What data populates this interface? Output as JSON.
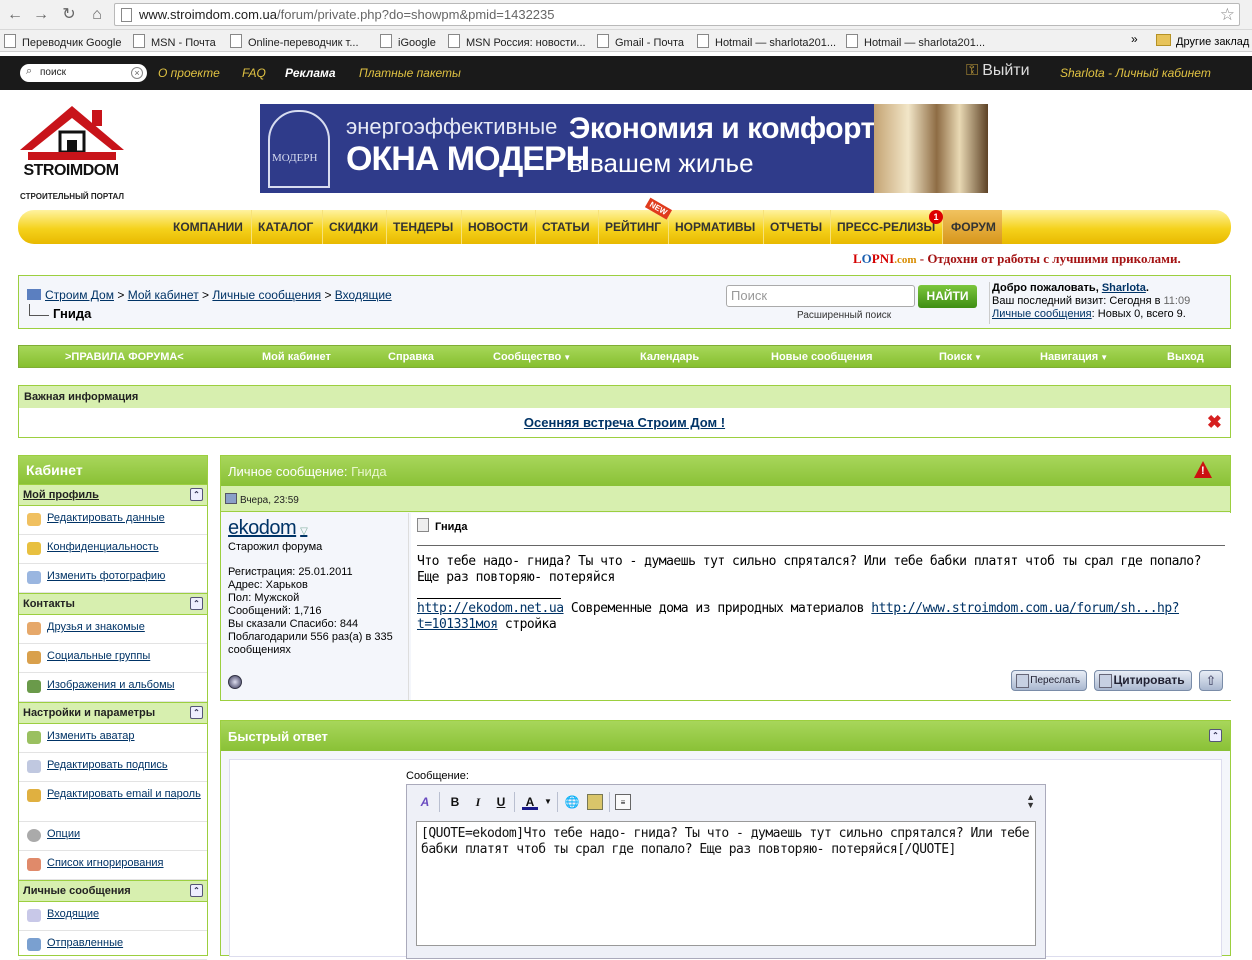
{
  "browser": {
    "url_host": "www.stroimdom.com.ua",
    "url_path": "/forum/private.php?do=showpm&pmid=1432235",
    "bookmarks": [
      "Переводчик Google",
      "MSN - Почта",
      "Online-переводчик т...",
      "iGoogle",
      "MSN Россия: новости...",
      "Gmail - Почта",
      "Hotmail — sharlota201...",
      "Hotmail — sharlota201..."
    ],
    "bookmarks_more": "»",
    "other_bookmarks": "Другие заклад"
  },
  "topbar": {
    "search_value": "поиск",
    "links": [
      "О проекте",
      "FAQ",
      "Реклама",
      "Платные пакеты"
    ],
    "login": "Выйти",
    "cabinet": "Sharlota - Личный кабинет"
  },
  "logo": {
    "name": "STROIMDOM",
    "subtitle": "СТРОИТЕЛЬНЫЙ ПОРТАЛ"
  },
  "banner": {
    "brand": "МОДЕРН",
    "line1": "энергоэффективные",
    "line2": "ОКНА МОДЕРН",
    "right1": "Экономия и комфорт",
    "right2": "в вашем жилье"
  },
  "mainnav": {
    "items": [
      "КОМПАНИИ",
      "КАТАЛОГ",
      "СКИДКИ",
      "ТЕНДЕРЫ",
      "НОВОСТИ",
      "СТАТЬИ",
      "РЕЙТИНГ",
      "НОРМАТИВЫ",
      "ОТЧЕТЫ",
      "ПРЕСС-РЕЛИЗЫ",
      "ФОРУМ"
    ],
    "new_tag": "NEW",
    "badge_count": "1"
  },
  "promo": {
    "brand_l": "L",
    "brand_o": "O",
    "brand_rest": "PNI",
    "brand_tld": ".com",
    "text": " - Отдохни от работы с лучшими приколами."
  },
  "breadcrumb": {
    "items": [
      "Строим Дом",
      "Мой кабинет",
      "Личные сообщения",
      "Входящие"
    ],
    "sep": ">",
    "current": "Гнида",
    "search_placeholder": "Поиск",
    "search_button": "НАЙТИ",
    "advanced": "Расширенный поиск",
    "welcome_prefix": "Добро пожаловать, ",
    "username": "Sharlota",
    "last_visit_label": "Ваш последний визит: Сегодня в ",
    "last_visit_time": "11:09",
    "pm_link": "Личные сообщения",
    "pm_stats": ": Новых 0, всего 9."
  },
  "forumnav": {
    "items": [
      ">ПРАВИЛА ФОРУМА<",
      "Мой кабинет",
      "Справка",
      "Сообщество",
      "Календарь",
      "Новые сообщения",
      "Поиск",
      "Навигация",
      "Выход"
    ]
  },
  "important": {
    "title": "Важная информация",
    "link": "Осенняя встреча Строим Дом !"
  },
  "sidebar": {
    "title": "Кабинет",
    "sections": [
      {
        "label": "Мой профиль",
        "items": [
          "Редактировать данные",
          "Конфиденциальность",
          "Изменить фотографию"
        ]
      },
      {
        "label": "Контакты",
        "items": [
          "Друзья и знакомые",
          "Социальные группы",
          "Изображения и альбомы"
        ]
      },
      {
        "label": "Настройки и параметры",
        "items": [
          "Изменить аватар",
          "Редактировать подпись",
          "Редактировать email и пароль",
          "Опции",
          "Список игнорирования"
        ]
      },
      {
        "label": "Личные сообщения",
        "items": [
          "Входящие",
          "Отправленные"
        ]
      }
    ]
  },
  "pm": {
    "header_label": "Личное сообщение",
    "header_subject": "Гнида",
    "date": "Вчера, 23:59",
    "author": "ekodom",
    "author_title": "Старожил форума",
    "info": [
      "Регистрация: 25.01.2011",
      "Адрес: Харьков",
      "Пол: Мужской",
      "Сообщений: 1,716",
      "Вы сказали Спасибо: 844",
      "Поблагодарили 556 раз(а) в 335 сообщениях"
    ],
    "title": "Гнида",
    "text": "Что тебе надо- гнида? Ты что - думаешь тут сильно спрятался? Или тебе бабки платят чтоб ты срал где попало? Еще раз повторяю- потеряйся",
    "sig_link1": "http://ekodom.net.ua",
    "sig_text1": " Современные дома из природных материалов ",
    "sig_link2": "http://www.stroimdom.com.ua/forum/sh...hp?t=101331моя",
    "sig_text2": " стройка",
    "btn_forward": "Переслать",
    "btn_quote": "Цитировать"
  },
  "quick_reply": {
    "title": "Быстрый ответ",
    "label": "Сообщение:",
    "text": "[QUOTE=ekodom]Что тебе надо- гнида? Ты что - думаешь тут сильно спрятался? Или тебе бабки платят чтоб ты срал где попало? Еще раз повторяю- потеряйся[/QUOTE]",
    "tools": [
      "B",
      "I",
      "U",
      "A"
    ]
  }
}
